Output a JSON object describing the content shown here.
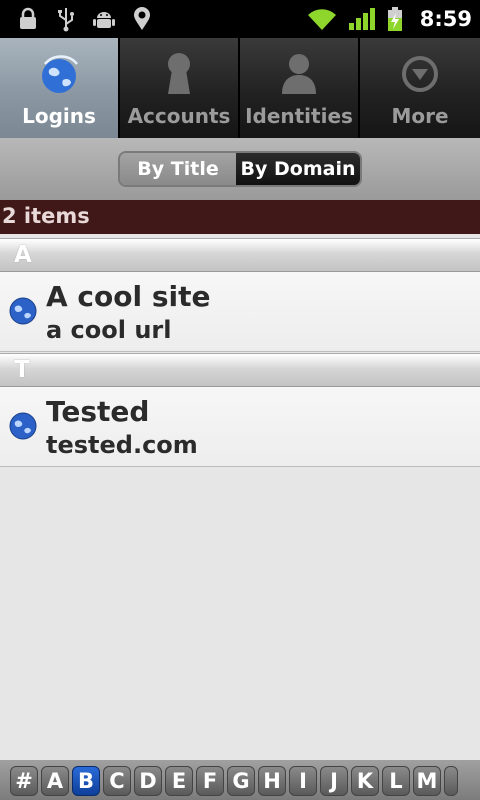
{
  "status_bar": {
    "time": "8:59"
  },
  "tabs": [
    {
      "label": "Logins",
      "icon": "globe-icon",
      "active": true
    },
    {
      "label": "Accounts",
      "icon": "keyhole-icon",
      "active": false
    },
    {
      "label": "Identities",
      "icon": "person-icon",
      "active": false
    },
    {
      "label": "More",
      "icon": "more-circle-icon",
      "active": false
    }
  ],
  "sort_toggle": {
    "by_title": "By Title",
    "by_domain": "By Domain",
    "selected": "By Domain"
  },
  "count_label": "2 items",
  "sections": [
    {
      "letter": "A",
      "items": [
        {
          "title": "A cool site",
          "subtitle": "a cool url"
        }
      ]
    },
    {
      "letter": "T",
      "items": [
        {
          "title": "Tested",
          "subtitle": "tested.com"
        }
      ]
    }
  ],
  "alphabet": {
    "letters": [
      "#",
      "A",
      "B",
      "C",
      "D",
      "E",
      "F",
      "G",
      "H",
      "I",
      "J",
      "K",
      "L",
      "M"
    ],
    "selected": "B"
  },
  "colors": {
    "active_tab": "#8b98a3",
    "count_bar": "#401818",
    "selected_letter": "#1a52b8"
  }
}
